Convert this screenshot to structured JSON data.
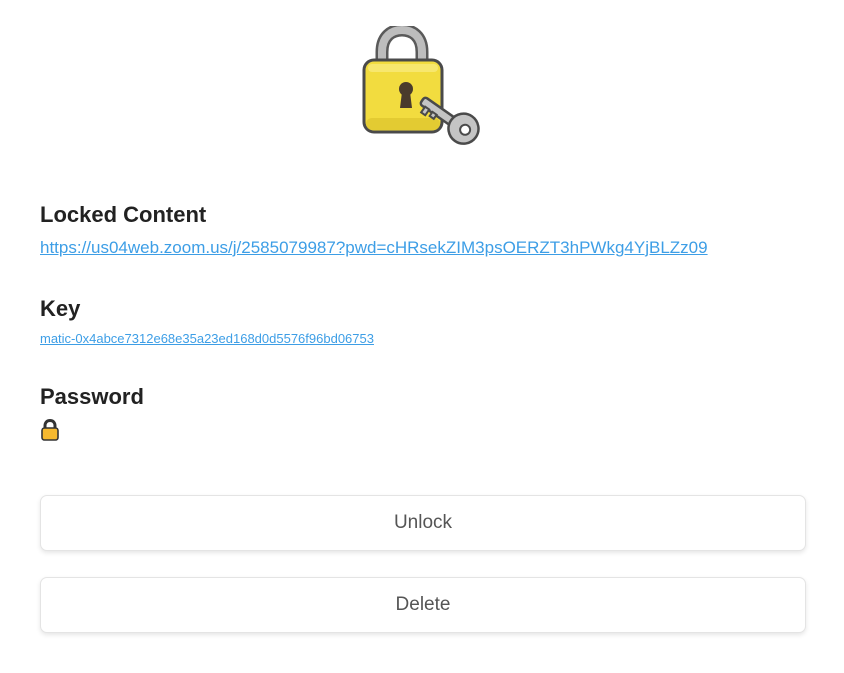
{
  "hero": {
    "icon": "padlock-with-key-icon"
  },
  "locked_content": {
    "heading": "Locked Content",
    "link": "https://us04web.zoom.us/j/2585079987?pwd=cHRsekZIM3psOERZT3hPWkg4YjBLZz09"
  },
  "key": {
    "heading": "Key",
    "value": "matic-0x4abce7312e68e35a23ed168d0d5576f96bd06753"
  },
  "password": {
    "heading": "Password",
    "icon": "lock-emoji-icon"
  },
  "actions": {
    "unlock_label": "Unlock",
    "delete_label": "Delete"
  },
  "colors": {
    "link": "#3d9ee6",
    "lock_body": "#f2dc3f",
    "lock_shackle": "#9e9e9e"
  }
}
